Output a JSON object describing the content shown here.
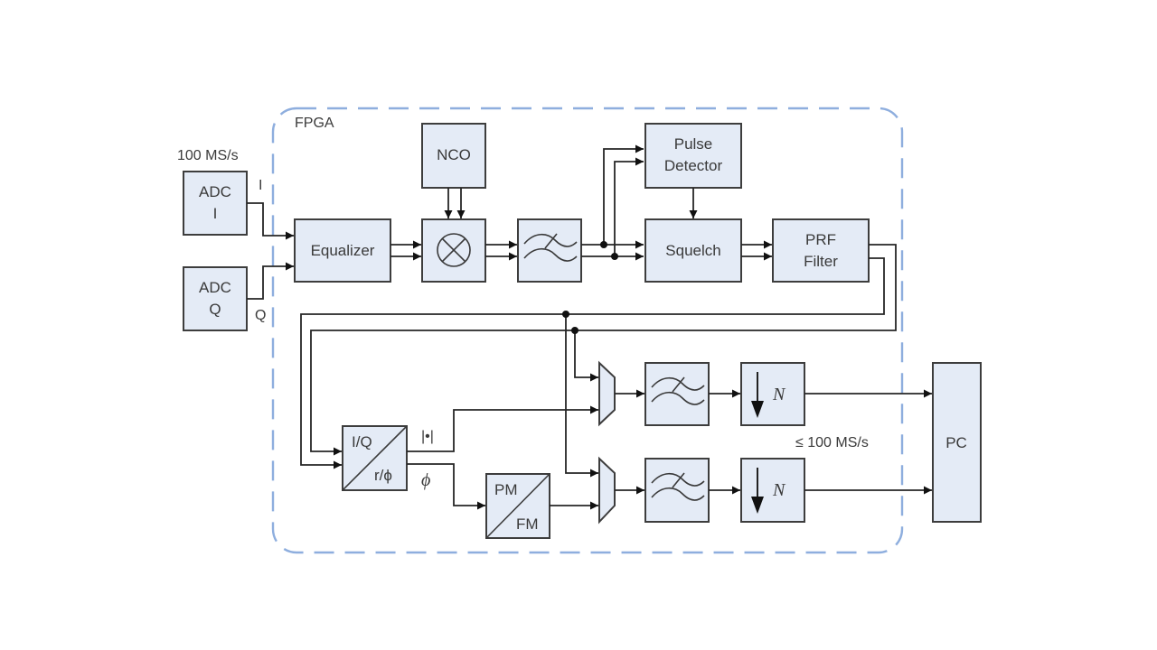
{
  "diagram": {
    "fpga_label": "FPGA",
    "input_rate": "100 MS/s",
    "output_rate": "≤ 100 MS/s",
    "blocks": {
      "adc_i": [
        "ADC",
        "I"
      ],
      "adc_q": [
        "ADC",
        "Q"
      ],
      "equalizer": "Equalizer",
      "nco": "NCO",
      "mixer": "mixer-icon",
      "lowpass": "lowpass-filter-icon",
      "pulse_detector": [
        "Pulse",
        "Detector"
      ],
      "squelch": "Squelch",
      "prf_filter": [
        "PRF",
        "Filter"
      ],
      "iq_converter": {
        "top": "I/Q",
        "bottom": "r/ϕ"
      },
      "pm_fm": {
        "top": "PM",
        "bottom": "FM"
      },
      "decimator": "N",
      "pc": "PC"
    },
    "signal_labels": {
      "i": "I",
      "q": "Q",
      "magnitude": "|•|",
      "phase": "ϕ"
    },
    "colors": {
      "block_fill": "#e4ebf6",
      "block_stroke": "#3d3d3d",
      "fpga_border": "#8eaede"
    }
  }
}
